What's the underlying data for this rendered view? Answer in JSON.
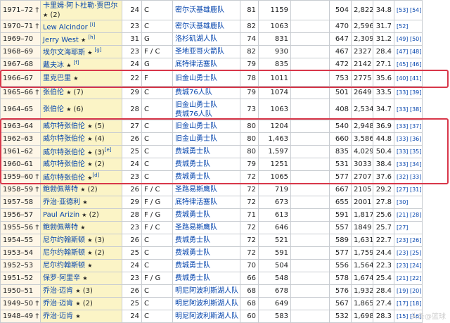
{
  "rows": [
    {
      "season": "1971–72",
      "dagger": "†",
      "player": "卡里姆·阿卜杜勒·贾巴尔",
      "star": "★",
      "note": "(2)",
      "age": "24",
      "pos": "C",
      "team": "密尔沃基雄鹿队",
      "g": "81",
      "fg": "1159",
      "fgp": "",
      "ft": "504",
      "pts": "2,822",
      "ppg": "34.8",
      "refs": "[53] [54]"
    },
    {
      "season": "1970–71",
      "dagger": "†",
      "player": "Lew Alcindor",
      "star": "",
      "note": "[i]",
      "age": "23",
      "pos": "C",
      "team": "密尔沃基雄鹿队",
      "g": "82",
      "fg": "1063",
      "fgp": "",
      "ft": "470",
      "pts": "2,596",
      "ppg": "31.7",
      "refs": "[52]"
    },
    {
      "season": "1969–70",
      "dagger": "",
      "player": "Jerry West",
      "star": "★",
      "note": "[h]",
      "age": "31",
      "pos": "G",
      "team": "洛杉矶湖人队",
      "g": "74",
      "fg": "831",
      "fgp": "",
      "ft": "647",
      "pts": "2,309",
      "ppg": "31.2",
      "refs": "[49] [50]"
    },
    {
      "season": "1968–69",
      "dagger": "",
      "player": "埃尔文海耶斯",
      "star": "★",
      "note": "[g]",
      "age": "23",
      "pos": "F / C",
      "team": "圣地亚哥火箭队",
      "g": "82",
      "fg": "930",
      "fgp": "",
      "ft": "467",
      "pts": "2327",
      "ppg": "28.4",
      "refs": "[47] [48]"
    },
    {
      "season": "1967–68",
      "dagger": "",
      "player": "戴夫冰",
      "star": "★",
      "note": "[f]",
      "age": "24",
      "pos": "G",
      "team": "底特律活塞队",
      "g": "79",
      "fg": "835",
      "fgp": "",
      "ft": "472",
      "pts": "2142",
      "ppg": "27.1",
      "refs": "[45] [46]"
    },
    {
      "season": "1966–67",
      "dagger": "",
      "player": "里克巴里",
      "star": "★",
      "note": "",
      "age": "22",
      "pos": "F",
      "team": "旧金山勇士队",
      "g": "78",
      "fg": "1011",
      "fgp": "",
      "ft": "753",
      "pts": "2775",
      "ppg": "35.6",
      "refs": "[40] [41]"
    },
    {
      "season": "1965–66",
      "dagger": "†",
      "player": "张伯伦",
      "star": "★",
      "note": "(7)",
      "age": "29",
      "pos": "C",
      "team": "费城76人队",
      "g": "79",
      "fg": "1074",
      "fgp": "",
      "ft": "501",
      "pts": "2649",
      "ppg": "33.5",
      "refs": "[33] [39]"
    },
    {
      "season": "1964–65",
      "dagger": "",
      "player": "张伯伦",
      "star": "★",
      "note": "(6)",
      "age": "28",
      "pos": "C",
      "team": "旧金山勇士队 费城76人队",
      "g": "73",
      "fg": "1063",
      "fgp": "",
      "ft": "408",
      "pts": "2,534",
      "ppg": "34.7",
      "refs": "[33] [38]"
    },
    {
      "season": "1963–64",
      "dagger": "",
      "player": "威尔特张伯伦",
      "star": "★",
      "note": "(5)",
      "age": "27",
      "pos": "C",
      "team": "旧金山勇士队",
      "g": "80",
      "fg": "1204",
      "fgp": "",
      "ft": "540",
      "pts": "2,948",
      "ppg": "36.9",
      "refs": "[33] [37]"
    },
    {
      "season": "1962–63",
      "dagger": "",
      "player": "威尔特张伯伦",
      "star": "★",
      "note": "(4)",
      "age": "26",
      "pos": "C",
      "team": "旧金山勇士队",
      "g": "80",
      "fg": "1,463",
      "fgp": "",
      "ft": "660",
      "pts": "3,586",
      "ppg": "44.8",
      "refs": "[33] [36]"
    },
    {
      "season": "1961–62",
      "dagger": "",
      "player": "威尔特张伯伦",
      "star": "★",
      "note": "(3)",
      "sup": "[e]",
      "age": "25",
      "pos": "C",
      "team": "费城勇士队",
      "g": "80",
      "fg": "1,597",
      "fgp": "",
      "ft": "835",
      "pts": "4,029",
      "ppg": "50.4",
      "refs": "[33] [35]"
    },
    {
      "season": "1960–61",
      "dagger": "",
      "player": "威尔特张伯伦",
      "star": "★",
      "note": "(2)",
      "age": "24",
      "pos": "C",
      "team": "费城勇士队",
      "g": "79",
      "fg": "1251",
      "fgp": "",
      "ft": "531",
      "pts": "3033",
      "ppg": "38.4",
      "refs": "[33] [34]"
    },
    {
      "season": "1959–60",
      "dagger": "†",
      "player": "威尔特张伯伦",
      "star": "★",
      "note": "",
      "sup": "[d]",
      "age": "23",
      "pos": "C",
      "team": "费城勇士队",
      "g": "72",
      "fg": "1065",
      "fgp": "",
      "ft": "577",
      "pts": "2707",
      "ppg": "37.6",
      "refs": "[32] [33]"
    },
    {
      "season": "1958–59",
      "dagger": "†",
      "player": "鲍勃佩蒂特",
      "star": "★",
      "note": "(2)",
      "age": "26",
      "pos": "F / C",
      "team": "圣路易斯鹰队",
      "g": "72",
      "fg": "719",
      "fgp": "",
      "ft": "667",
      "pts": "2105",
      "ppg": "29.2",
      "refs": "[27] [31]"
    },
    {
      "season": "1957–58",
      "dagger": "",
      "player": "乔治·亚德利",
      "star": "★",
      "note": "",
      "age": "29",
      "pos": "F / G",
      "team": "底特律活塞队",
      "g": "72",
      "fg": "673",
      "fgp": "",
      "ft": "655",
      "pts": "2001",
      "ppg": "27.8",
      "refs": "[30]"
    },
    {
      "season": "1956–57",
      "dagger": "",
      "player": "Paul Arizin",
      "star": "★",
      "note": "(2)",
      "age": "28",
      "pos": "F / G",
      "team": "费城勇士队",
      "g": "71",
      "fg": "613",
      "fgp": "",
      "ft": "591",
      "pts": "1,817",
      "ppg": "25.6",
      "refs": "[21] [28]"
    },
    {
      "season": "1955–56",
      "dagger": "†",
      "player": "鲍勃佩蒂特",
      "star": "★",
      "note": "",
      "age": "23",
      "pos": "F / C",
      "team": "圣路易斯鹰队",
      "g": "72",
      "fg": "646",
      "fgp": "",
      "ft": "557",
      "pts": "1849",
      "ppg": "25.7",
      "refs": "[27]"
    },
    {
      "season": "1954–55",
      "dagger": "",
      "player": "尼尔约翰斯顿",
      "star": "★",
      "note": "(3)",
      "age": "26",
      "pos": "C",
      "team": "费城勇士队",
      "g": "72",
      "fg": "521",
      "fgp": "",
      "ft": "589",
      "pts": "1,631",
      "ppg": "22.7",
      "refs": "[23] [26]"
    },
    {
      "season": "1953–54",
      "dagger": "",
      "player": "尼尔约翰斯顿",
      "star": "★",
      "note": "(2)",
      "age": "25",
      "pos": "C",
      "team": "费城勇士队",
      "g": "72",
      "fg": "591",
      "fgp": "",
      "ft": "577",
      "pts": "1,759",
      "ppg": "24.4",
      "refs": "[23] [25]"
    },
    {
      "season": "1952–53",
      "dagger": "",
      "player": "尼尔约翰斯顿",
      "star": "★",
      "note": "",
      "age": "24",
      "pos": "C",
      "team": "费城勇士队",
      "g": "70",
      "fg": "504",
      "fgp": "",
      "ft": "556",
      "pts": "1,564",
      "ppg": "22.3",
      "refs": "[23] [24]"
    },
    {
      "season": "1951–52",
      "dagger": "",
      "player": "保罗·阿里辛",
      "star": "★",
      "note": "",
      "age": "23",
      "pos": "F / G",
      "team": "费城勇士队",
      "g": "66",
      "fg": "548",
      "fgp": "",
      "ft": "578",
      "pts": "1,674",
      "ppg": "25.4",
      "refs": "[21] [22]"
    },
    {
      "season": "1950–51",
      "dagger": "",
      "player": "乔治·迈肯",
      "star": "★",
      "note": "(3)",
      "age": "26",
      "pos": "C",
      "team": "明尼阿波利斯湖人队",
      "g": "68",
      "fg": "678",
      "fgp": "",
      "ft": "576",
      "pts": "1,932",
      "ppg": "28.4",
      "refs": "[19] [20]"
    },
    {
      "season": "1949–50",
      "dagger": "†",
      "player": "乔治·迈肯",
      "star": "★",
      "note": "(2)",
      "age": "25",
      "pos": "C",
      "team": "明尼阿波利斯湖人队",
      "g": "68",
      "fg": "649",
      "fgp": "",
      "ft": "567",
      "pts": "1,865",
      "ppg": "27.4",
      "refs": "[17] [18]"
    },
    {
      "season": "1948–49",
      "dagger": "†",
      "player": "乔治·迈肯",
      "star": "★",
      "note": "",
      "age": "24",
      "pos": "C",
      "team": "明尼阿波利斯湖人队",
      "g": "60",
      "fg": "583",
      "fgp": "",
      "ft": "532",
      "pts": "1,698",
      "ppg": "28.3",
      "refs": "[15] [16]"
    }
  ],
  "watermark": "头条@篮球"
}
